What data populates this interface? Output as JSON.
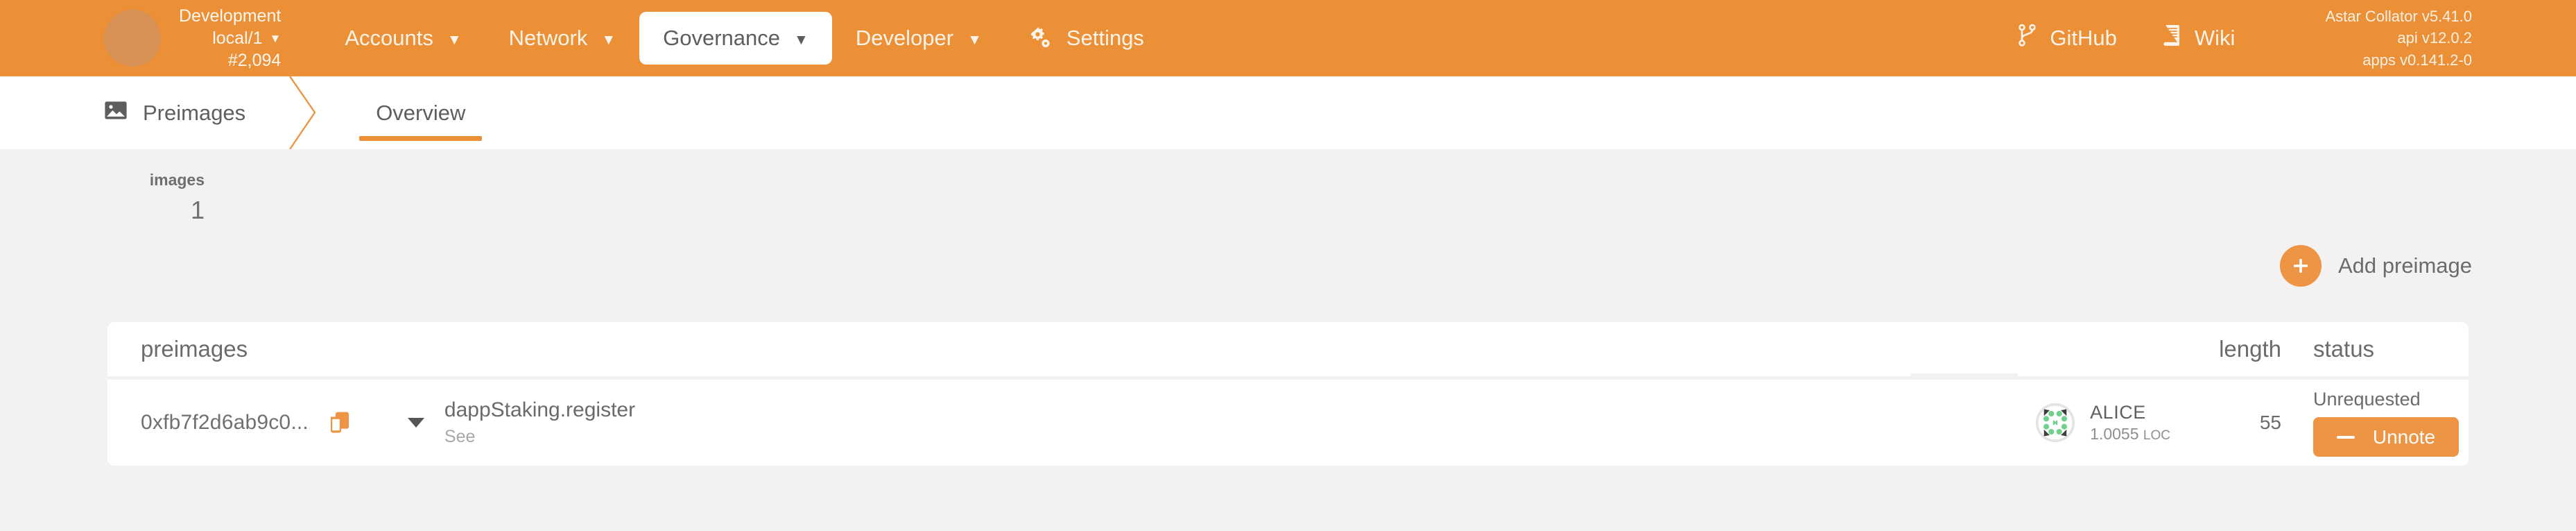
{
  "topbar": {
    "chain": {
      "name": "Development",
      "endpoint": "local/1",
      "block": "#2,094",
      "caret": "▼"
    },
    "nav": [
      {
        "label": "Accounts",
        "caret": "▼",
        "active": false
      },
      {
        "label": "Network",
        "caret": "▼",
        "active": false
      },
      {
        "label": "Governance",
        "caret": "▼",
        "active": true
      },
      {
        "label": "Developer",
        "caret": "▼",
        "active": false
      },
      {
        "label": "Settings",
        "caret": "",
        "active": false,
        "icon": "gear-icon"
      }
    ],
    "external_links": [
      {
        "label": "GitHub",
        "icon": "git-branch-icon"
      },
      {
        "label": "Wiki",
        "icon": "book-icon"
      }
    ],
    "versions": {
      "node": "Astar Collator v5.41.0",
      "api": "api v12.0.2",
      "apps": "apps v0.141.2-0"
    }
  },
  "tabbar": {
    "section": {
      "label": "Preimages",
      "icon": "image-icon"
    },
    "tabs": [
      {
        "label": "Overview",
        "active": true
      }
    ]
  },
  "summary": {
    "label": "images",
    "value": "1"
  },
  "actions": {
    "add_preimage": "Add preimage",
    "plus_icon": "plus-icon"
  },
  "table": {
    "headers": {
      "preimages": "preimages",
      "length": "length",
      "status": "status"
    },
    "rows": [
      {
        "hash": "0xfb7f2d6ab9c0...",
        "copy_icon": "copy-icon",
        "expand_icon": "chevron-down-icon",
        "call": "dappStaking.register",
        "call_sub": "See",
        "account": {
          "name": "ALICE",
          "balance": "1.0055",
          "unit": "LOC"
        },
        "length": "55",
        "status": "Unrequested",
        "action_label": "Unnote",
        "action_icon": "minus-icon"
      }
    ]
  },
  "colors": {
    "brand_orange": "#ec9038",
    "button_orange": "#ee9445",
    "page_background": "#f4f2f1",
    "card_white": "#ffffff",
    "identicon_green": "#6fd18b"
  }
}
